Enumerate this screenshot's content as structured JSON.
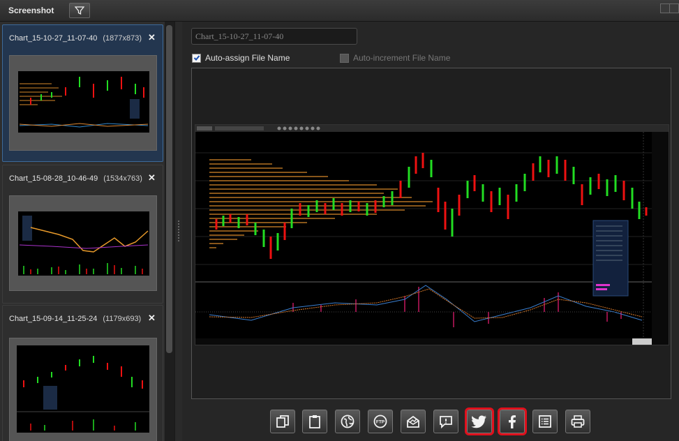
{
  "window": {
    "title": "Screenshot"
  },
  "icons": {
    "filter": "filter-icon",
    "close": "close-icon"
  },
  "thumbnails": [
    {
      "name": "Chart_15-10-27_11-07-40",
      "size": "(1877x873)",
      "selected": true
    },
    {
      "name": "Chart_15-08-28_10-46-49",
      "size": "(1534x763)",
      "selected": false
    },
    {
      "name": "Chart_15-09-14_11-25-24",
      "size": "(1179x693)",
      "selected": false
    }
  ],
  "file_name": {
    "value": "Chart_15-10-27_11-07-40"
  },
  "options": {
    "auto_assign_label": "Auto-assign File Name",
    "auto_assign_checked": true,
    "auto_increment_label": "Auto-increment File Name",
    "auto_increment_checked": false,
    "auto_increment_enabled": false
  },
  "toolbar": [
    {
      "id": "copy",
      "icon": "copy-icon"
    },
    {
      "id": "clipboard",
      "icon": "clipboard-icon"
    },
    {
      "id": "web",
      "icon": "globe-icon"
    },
    {
      "id": "ftp",
      "icon": "ftp-icon"
    },
    {
      "id": "email",
      "icon": "email-icon"
    },
    {
      "id": "comment",
      "icon": "comment-icon"
    },
    {
      "id": "twitter",
      "icon": "twitter-icon",
      "highlighted": true
    },
    {
      "id": "facebook",
      "icon": "facebook-icon",
      "highlighted": true
    },
    {
      "id": "list",
      "icon": "list-icon"
    },
    {
      "id": "print",
      "icon": "printer-icon"
    }
  ],
  "colors": {
    "selected_bg": "#23364f",
    "highlight": "#e0101c",
    "bull": "#22dd22",
    "bear": "#ee1111",
    "profile": "#d98a2a"
  }
}
